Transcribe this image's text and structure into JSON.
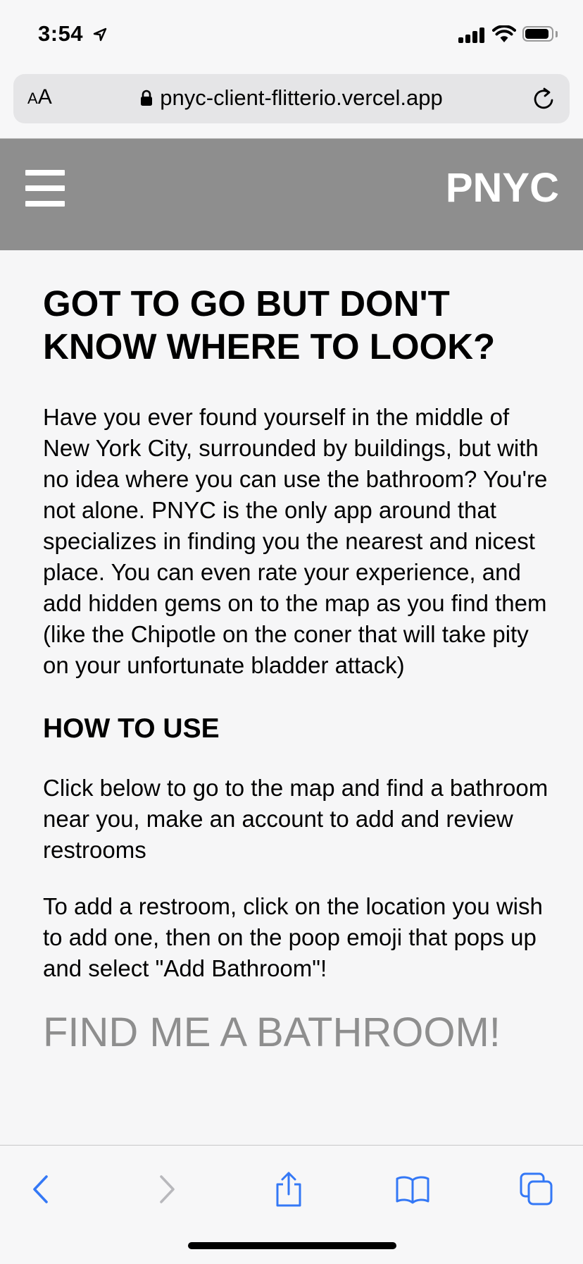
{
  "status_bar": {
    "time": "3:54"
  },
  "browser": {
    "aa_label_small": "A",
    "aa_label_large": "A",
    "url": "pnyc-client-flitterio.vercel.app"
  },
  "header": {
    "brand": "PNYC"
  },
  "main": {
    "title": "GOT TO GO BUT DON'T KNOW WHERE TO LOOK?",
    "intro": "Have you ever found yourself in the middle of New York City, surrounded by buildings, but with no idea where you can use the bathroom? You're not alone. PNYC is the only app around that specializes in finding you the nearest and nicest place. You can even rate your experience, and add hidden gems on to the map as you find them (like the Chipotle on the coner that will take pity on your unfortunate bladder attack)",
    "how_to_heading": "HOW TO USE",
    "how_to_1": "Click below to go to the map and find a bathroom near you, make an account to add and review restrooms",
    "how_to_2": "To add a restroom, click on the location you wish to add one, then on the poop emoji that pops up and select \"Add Bathroom\"!",
    "cta": "FIND ME A BATHROOM!"
  },
  "colors": {
    "header_bg": "#8e8e8e",
    "cta_text": "#8e8e8e",
    "toolbar_icons": "#3478f6",
    "toolbar_disabled": "#b8b8bc"
  },
  "toolbar": {
    "icons": [
      "back-icon",
      "forward-icon",
      "share-icon",
      "bookmarks-icon",
      "tabs-icon"
    ]
  }
}
